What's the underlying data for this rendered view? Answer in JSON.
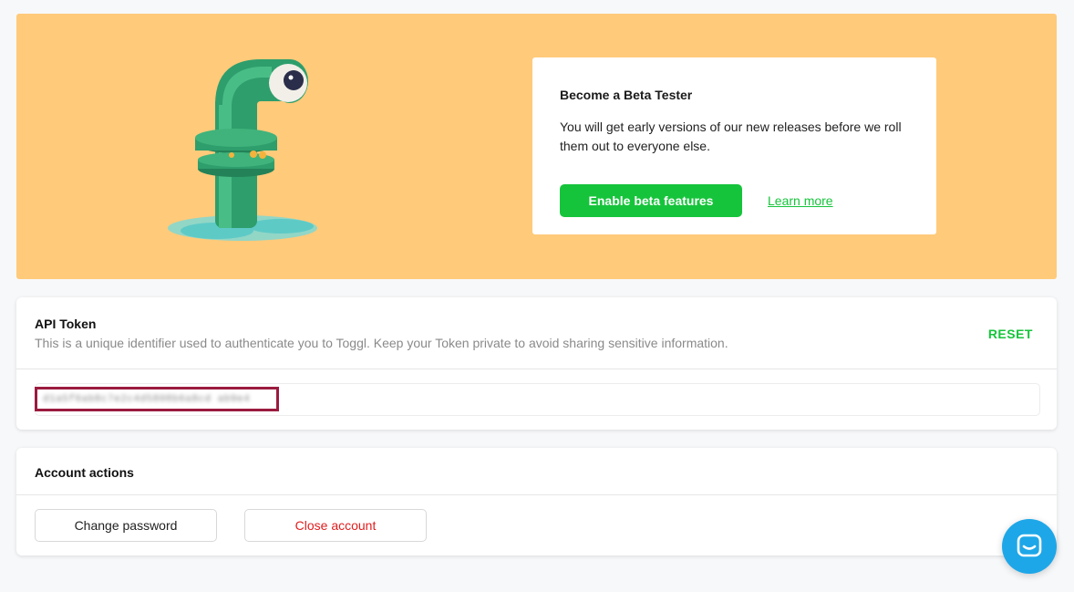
{
  "beta": {
    "title": "Become a Beta Tester",
    "description": "You will get early versions of our new releases before we roll them out to everyone else.",
    "enable_label": "Enable beta features",
    "learn_more_label": "Learn more",
    "banner_color": "#ffca7a"
  },
  "api_token": {
    "title": "API Token",
    "description": "This is a unique identifier used to authenticate you to Toggl. Keep your Token private to avoid sharing sensitive information.",
    "reset_label": "RESET",
    "token_value": "d1a5f6ab8c7e2c4d5808b6a8cd ab9e4"
  },
  "account_actions": {
    "title": "Account actions",
    "change_password_label": "Change password",
    "close_account_label": "Close account"
  },
  "chat": {
    "icon": "chat-bubble-icon"
  },
  "colors": {
    "accent_green": "#16c43b",
    "danger_red": "#e21d1d",
    "chat_blue": "#1ea7e8"
  }
}
